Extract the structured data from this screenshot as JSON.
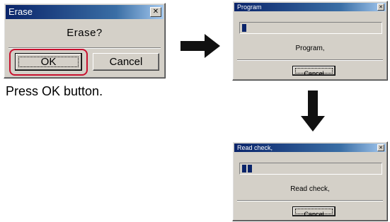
{
  "erase_dialog": {
    "title": "Erase",
    "close_glyph": "✕",
    "message": "Erase?",
    "ok_label": "OK",
    "cancel_label": "Cancel",
    "highlight_color": "#c8102e"
  },
  "caption": "Press OK button.",
  "program_dialog": {
    "title": "Program",
    "close_glyph": "✕",
    "message": "Program,",
    "cancel_label": "Cancel",
    "progress_blocks": 1
  },
  "readcheck_dialog": {
    "title": "Read check,",
    "close_glyph": "✕",
    "message": "Read check,",
    "cancel_label": "Cancel",
    "progress_blocks": 2
  },
  "arrows": [
    "arrow-right-icon",
    "arrow-down-icon"
  ]
}
